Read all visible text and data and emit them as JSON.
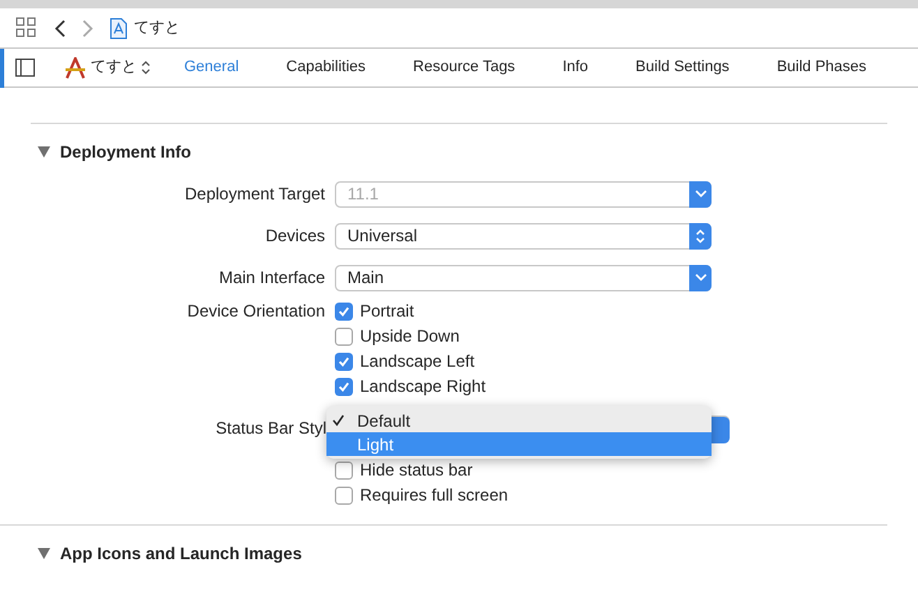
{
  "toolbar": {
    "title": "てすと"
  },
  "tab_bar": {
    "target": "てすと",
    "tabs": [
      {
        "label": "General",
        "selected": true
      },
      {
        "label": "Capabilities",
        "selected": false
      },
      {
        "label": "Resource Tags",
        "selected": false
      },
      {
        "label": "Info",
        "selected": false
      },
      {
        "label": "Build Settings",
        "selected": false
      },
      {
        "label": "Build Phases",
        "selected": false
      }
    ]
  },
  "sections": [
    {
      "title": "Deployment Info",
      "expanded": true,
      "rows": [
        {
          "kind": "select",
          "label": "Deployment Target",
          "value": "11.1",
          "disabled": true,
          "updown": false
        },
        {
          "kind": "select",
          "label": "Devices",
          "value": "Universal",
          "disabled": false,
          "updown": true
        },
        {
          "kind": "select",
          "label": "Main Interface",
          "value": "Main",
          "disabled": false,
          "updown": false
        },
        {
          "kind": "checks",
          "label": "Device Orientation",
          "options": [
            {
              "label": "Portrait",
              "checked": true
            },
            {
              "label": "Upside Down",
              "checked": false
            },
            {
              "label": "Landscape Left",
              "checked": true
            },
            {
              "label": "Landscape Right",
              "checked": true
            }
          ]
        },
        {
          "kind": "menu",
          "label": "Status Bar Styl",
          "items": [
            {
              "label": "Default",
              "selected": true
            },
            {
              "label": "Light",
              "selected": false
            }
          ]
        },
        {
          "kind": "checks",
          "label": "",
          "options": [
            {
              "label": "Hide status bar",
              "checked": false
            },
            {
              "label": "Requires full screen",
              "checked": false
            }
          ]
        }
      ]
    },
    {
      "title": "App Icons and Launch Images",
      "expanded": true
    }
  ]
}
